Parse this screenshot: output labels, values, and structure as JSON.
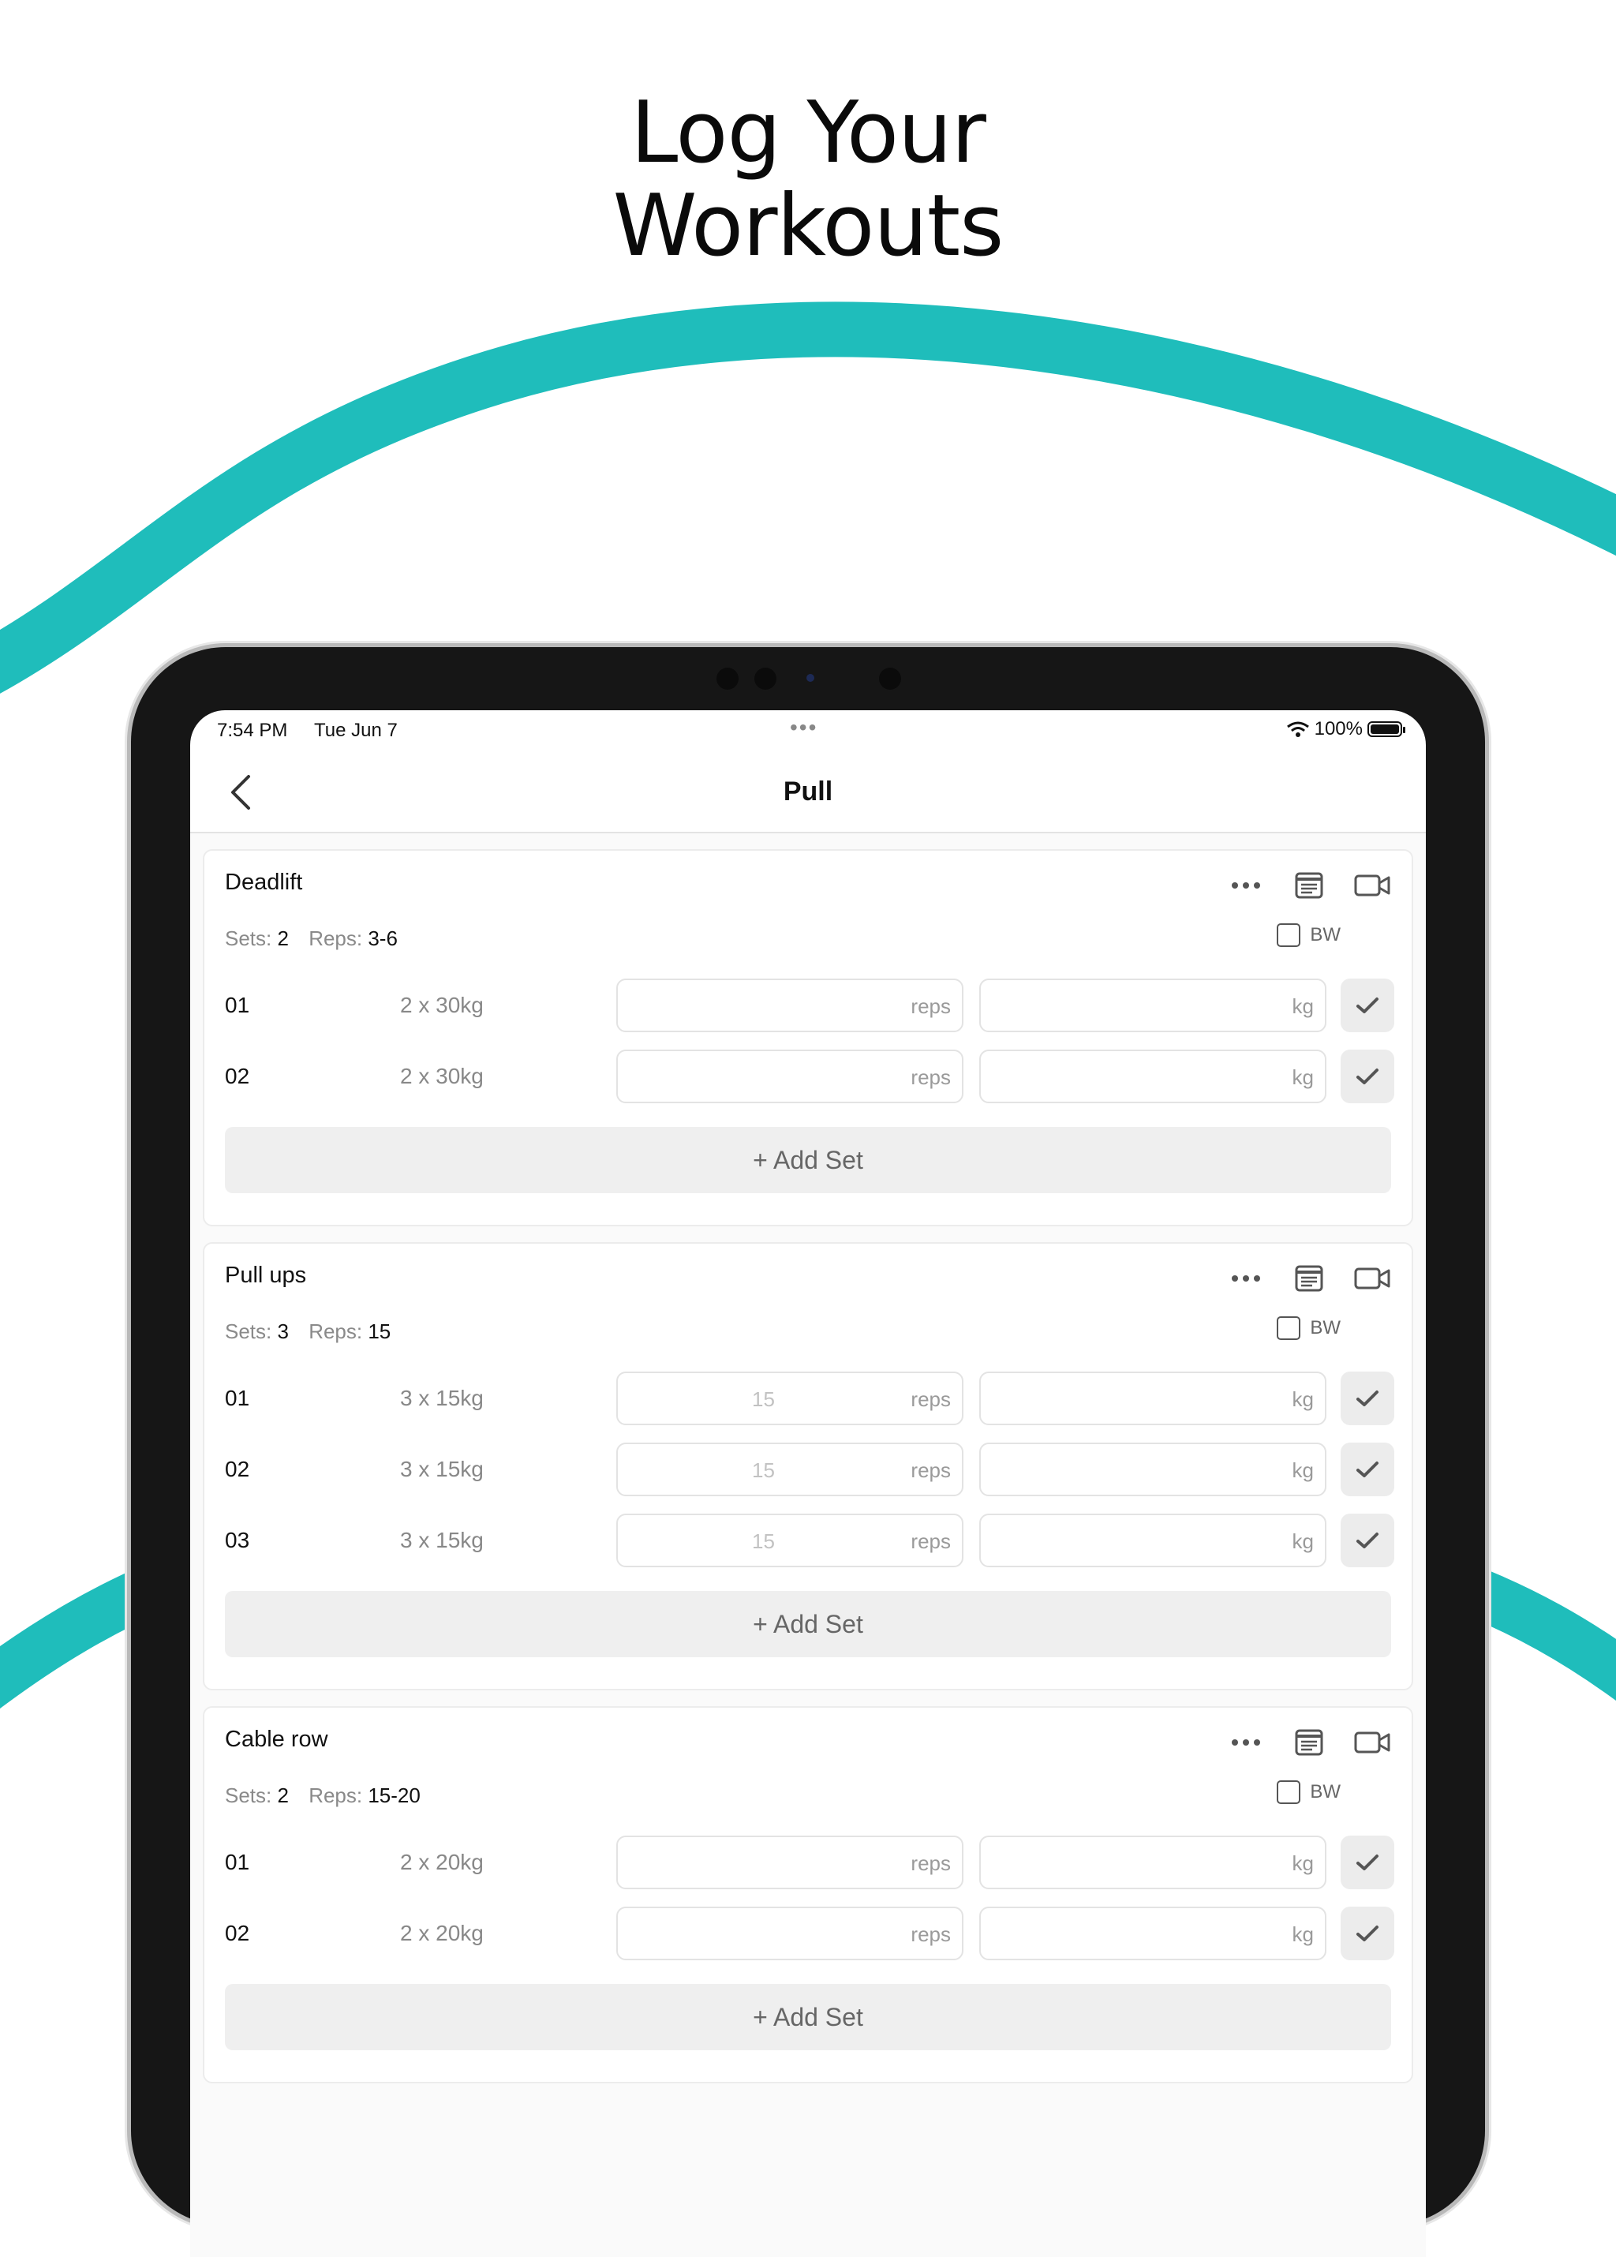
{
  "headline": {
    "line1": "Log Your",
    "line2": "Workouts"
  },
  "colors": {
    "accent": "#1fbdbb",
    "bezel": "#161616",
    "button_bg": "#efefef"
  },
  "status_bar": {
    "time": "7:54 PM",
    "date": "Tue Jun 7",
    "dots": "•••",
    "battery": "100%"
  },
  "nav": {
    "title": "Pull",
    "back_icon": "chevron-left-icon"
  },
  "labels": {
    "sets": "Sets:",
    "reps": "Reps:",
    "bw": "BW",
    "reps_placeholder": "reps",
    "kg_placeholder": "kg",
    "add_set": "+ Add Set"
  },
  "exercises": [
    {
      "name": "Deadlift",
      "sets": "2",
      "reps": "3-6",
      "set_rows": [
        {
          "num": "01",
          "target": "2 x 30kg",
          "reps_value": ""
        },
        {
          "num": "02",
          "target": "2 x 30kg",
          "reps_value": ""
        }
      ]
    },
    {
      "name": "Pull ups",
      "sets": "3",
      "reps": "15",
      "set_rows": [
        {
          "num": "01",
          "target": "3 x 15kg",
          "reps_value": "15"
        },
        {
          "num": "02",
          "target": "3 x 15kg",
          "reps_value": "15"
        },
        {
          "num": "03",
          "target": "3 x 15kg",
          "reps_value": "15"
        }
      ]
    },
    {
      "name": "Cable row",
      "sets": "2",
      "reps": "15-20",
      "set_rows": [
        {
          "num": "01",
          "target": "2 x 20kg",
          "reps_value": ""
        },
        {
          "num": "02",
          "target": "2 x 20kg",
          "reps_value": ""
        }
      ]
    }
  ]
}
